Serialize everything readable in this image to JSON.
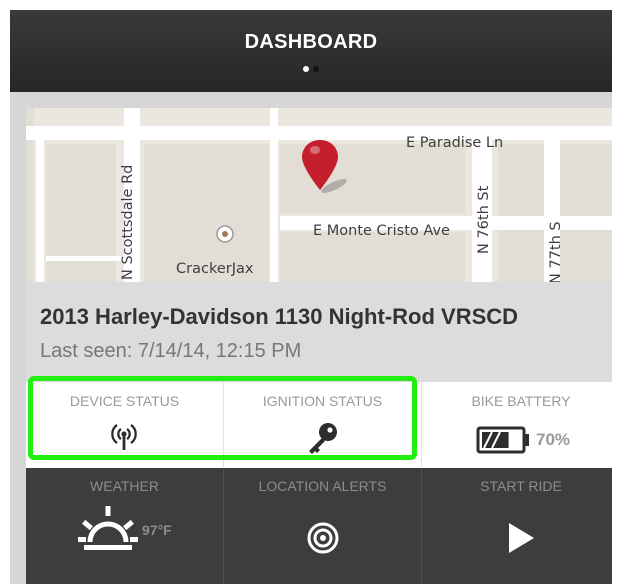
{
  "header": {
    "title": "DASHBOARD",
    "pages": 2,
    "active_page": 1
  },
  "map": {
    "labels": {
      "e_paradise": "E Paradise Ln",
      "e_monte_cristo": "E Monte Cristo Ave",
      "crackerjax": "CrackerJax",
      "scottsdale": "N Scottsdale Rd",
      "n76": "N 76th St",
      "n77": "N 77th S"
    }
  },
  "vehicle": {
    "name": "2013 Harley-Davidson 1130 Night-Rod VRSCD",
    "last_seen": "Last seen: 7/14/14, 12:15 PM"
  },
  "tiles": {
    "device_status": {
      "label": "DEVICE STATUS",
      "icon": "signal-tower-icon"
    },
    "ignition_status": {
      "label": "IGNITION STATUS",
      "icon": "key-icon"
    },
    "bike_battery": {
      "label": "BIKE BATTERY",
      "value": "70%",
      "level": 0.7,
      "icon": "battery-icon"
    },
    "weather": {
      "label": "WEATHER",
      "value": "97°F",
      "icon": "sun-icon"
    },
    "location_alerts": {
      "label": "LOCATION ALERTS",
      "icon": "target-icon"
    },
    "start_ride": {
      "label": "START RIDE",
      "icon": "play-icon"
    }
  },
  "colors": {
    "highlight": "#22ee10",
    "header_bg": "#2e2e2e",
    "dark_tiles": "#3d3d3d",
    "pin": "#c41e2c"
  }
}
